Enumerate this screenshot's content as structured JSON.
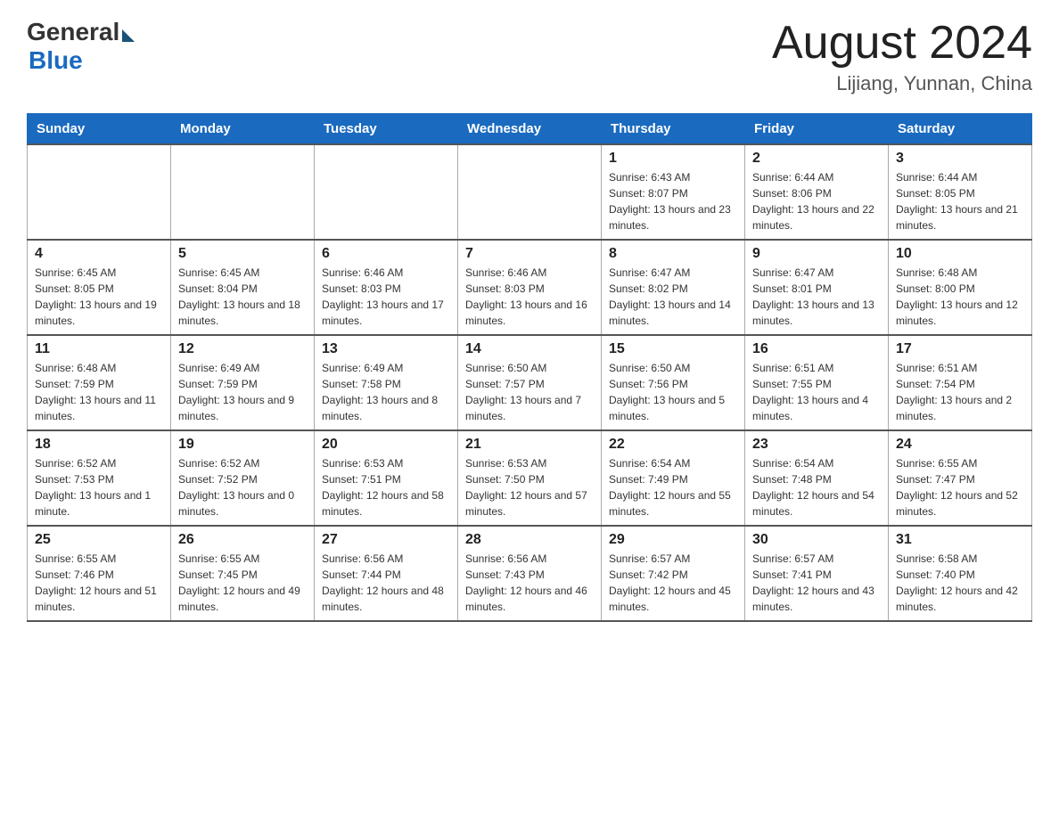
{
  "header": {
    "logo_general": "General",
    "logo_blue": "Blue",
    "month_title": "August 2024",
    "location": "Lijiang, Yunnan, China"
  },
  "days_of_week": [
    "Sunday",
    "Monday",
    "Tuesday",
    "Wednesday",
    "Thursday",
    "Friday",
    "Saturday"
  ],
  "weeks": [
    [
      {
        "day": "",
        "info": ""
      },
      {
        "day": "",
        "info": ""
      },
      {
        "day": "",
        "info": ""
      },
      {
        "day": "",
        "info": ""
      },
      {
        "day": "1",
        "info": "Sunrise: 6:43 AM\nSunset: 8:07 PM\nDaylight: 13 hours and 23 minutes."
      },
      {
        "day": "2",
        "info": "Sunrise: 6:44 AM\nSunset: 8:06 PM\nDaylight: 13 hours and 22 minutes."
      },
      {
        "day": "3",
        "info": "Sunrise: 6:44 AM\nSunset: 8:05 PM\nDaylight: 13 hours and 21 minutes."
      }
    ],
    [
      {
        "day": "4",
        "info": "Sunrise: 6:45 AM\nSunset: 8:05 PM\nDaylight: 13 hours and 19 minutes."
      },
      {
        "day": "5",
        "info": "Sunrise: 6:45 AM\nSunset: 8:04 PM\nDaylight: 13 hours and 18 minutes."
      },
      {
        "day": "6",
        "info": "Sunrise: 6:46 AM\nSunset: 8:03 PM\nDaylight: 13 hours and 17 minutes."
      },
      {
        "day": "7",
        "info": "Sunrise: 6:46 AM\nSunset: 8:03 PM\nDaylight: 13 hours and 16 minutes."
      },
      {
        "day": "8",
        "info": "Sunrise: 6:47 AM\nSunset: 8:02 PM\nDaylight: 13 hours and 14 minutes."
      },
      {
        "day": "9",
        "info": "Sunrise: 6:47 AM\nSunset: 8:01 PM\nDaylight: 13 hours and 13 minutes."
      },
      {
        "day": "10",
        "info": "Sunrise: 6:48 AM\nSunset: 8:00 PM\nDaylight: 13 hours and 12 minutes."
      }
    ],
    [
      {
        "day": "11",
        "info": "Sunrise: 6:48 AM\nSunset: 7:59 PM\nDaylight: 13 hours and 11 minutes."
      },
      {
        "day": "12",
        "info": "Sunrise: 6:49 AM\nSunset: 7:59 PM\nDaylight: 13 hours and 9 minutes."
      },
      {
        "day": "13",
        "info": "Sunrise: 6:49 AM\nSunset: 7:58 PM\nDaylight: 13 hours and 8 minutes."
      },
      {
        "day": "14",
        "info": "Sunrise: 6:50 AM\nSunset: 7:57 PM\nDaylight: 13 hours and 7 minutes."
      },
      {
        "day": "15",
        "info": "Sunrise: 6:50 AM\nSunset: 7:56 PM\nDaylight: 13 hours and 5 minutes."
      },
      {
        "day": "16",
        "info": "Sunrise: 6:51 AM\nSunset: 7:55 PM\nDaylight: 13 hours and 4 minutes."
      },
      {
        "day": "17",
        "info": "Sunrise: 6:51 AM\nSunset: 7:54 PM\nDaylight: 13 hours and 2 minutes."
      }
    ],
    [
      {
        "day": "18",
        "info": "Sunrise: 6:52 AM\nSunset: 7:53 PM\nDaylight: 13 hours and 1 minute."
      },
      {
        "day": "19",
        "info": "Sunrise: 6:52 AM\nSunset: 7:52 PM\nDaylight: 13 hours and 0 minutes."
      },
      {
        "day": "20",
        "info": "Sunrise: 6:53 AM\nSunset: 7:51 PM\nDaylight: 12 hours and 58 minutes."
      },
      {
        "day": "21",
        "info": "Sunrise: 6:53 AM\nSunset: 7:50 PM\nDaylight: 12 hours and 57 minutes."
      },
      {
        "day": "22",
        "info": "Sunrise: 6:54 AM\nSunset: 7:49 PM\nDaylight: 12 hours and 55 minutes."
      },
      {
        "day": "23",
        "info": "Sunrise: 6:54 AM\nSunset: 7:48 PM\nDaylight: 12 hours and 54 minutes."
      },
      {
        "day": "24",
        "info": "Sunrise: 6:55 AM\nSunset: 7:47 PM\nDaylight: 12 hours and 52 minutes."
      }
    ],
    [
      {
        "day": "25",
        "info": "Sunrise: 6:55 AM\nSunset: 7:46 PM\nDaylight: 12 hours and 51 minutes."
      },
      {
        "day": "26",
        "info": "Sunrise: 6:55 AM\nSunset: 7:45 PM\nDaylight: 12 hours and 49 minutes."
      },
      {
        "day": "27",
        "info": "Sunrise: 6:56 AM\nSunset: 7:44 PM\nDaylight: 12 hours and 48 minutes."
      },
      {
        "day": "28",
        "info": "Sunrise: 6:56 AM\nSunset: 7:43 PM\nDaylight: 12 hours and 46 minutes."
      },
      {
        "day": "29",
        "info": "Sunrise: 6:57 AM\nSunset: 7:42 PM\nDaylight: 12 hours and 45 minutes."
      },
      {
        "day": "30",
        "info": "Sunrise: 6:57 AM\nSunset: 7:41 PM\nDaylight: 12 hours and 43 minutes."
      },
      {
        "day": "31",
        "info": "Sunrise: 6:58 AM\nSunset: 7:40 PM\nDaylight: 12 hours and 42 minutes."
      }
    ]
  ]
}
